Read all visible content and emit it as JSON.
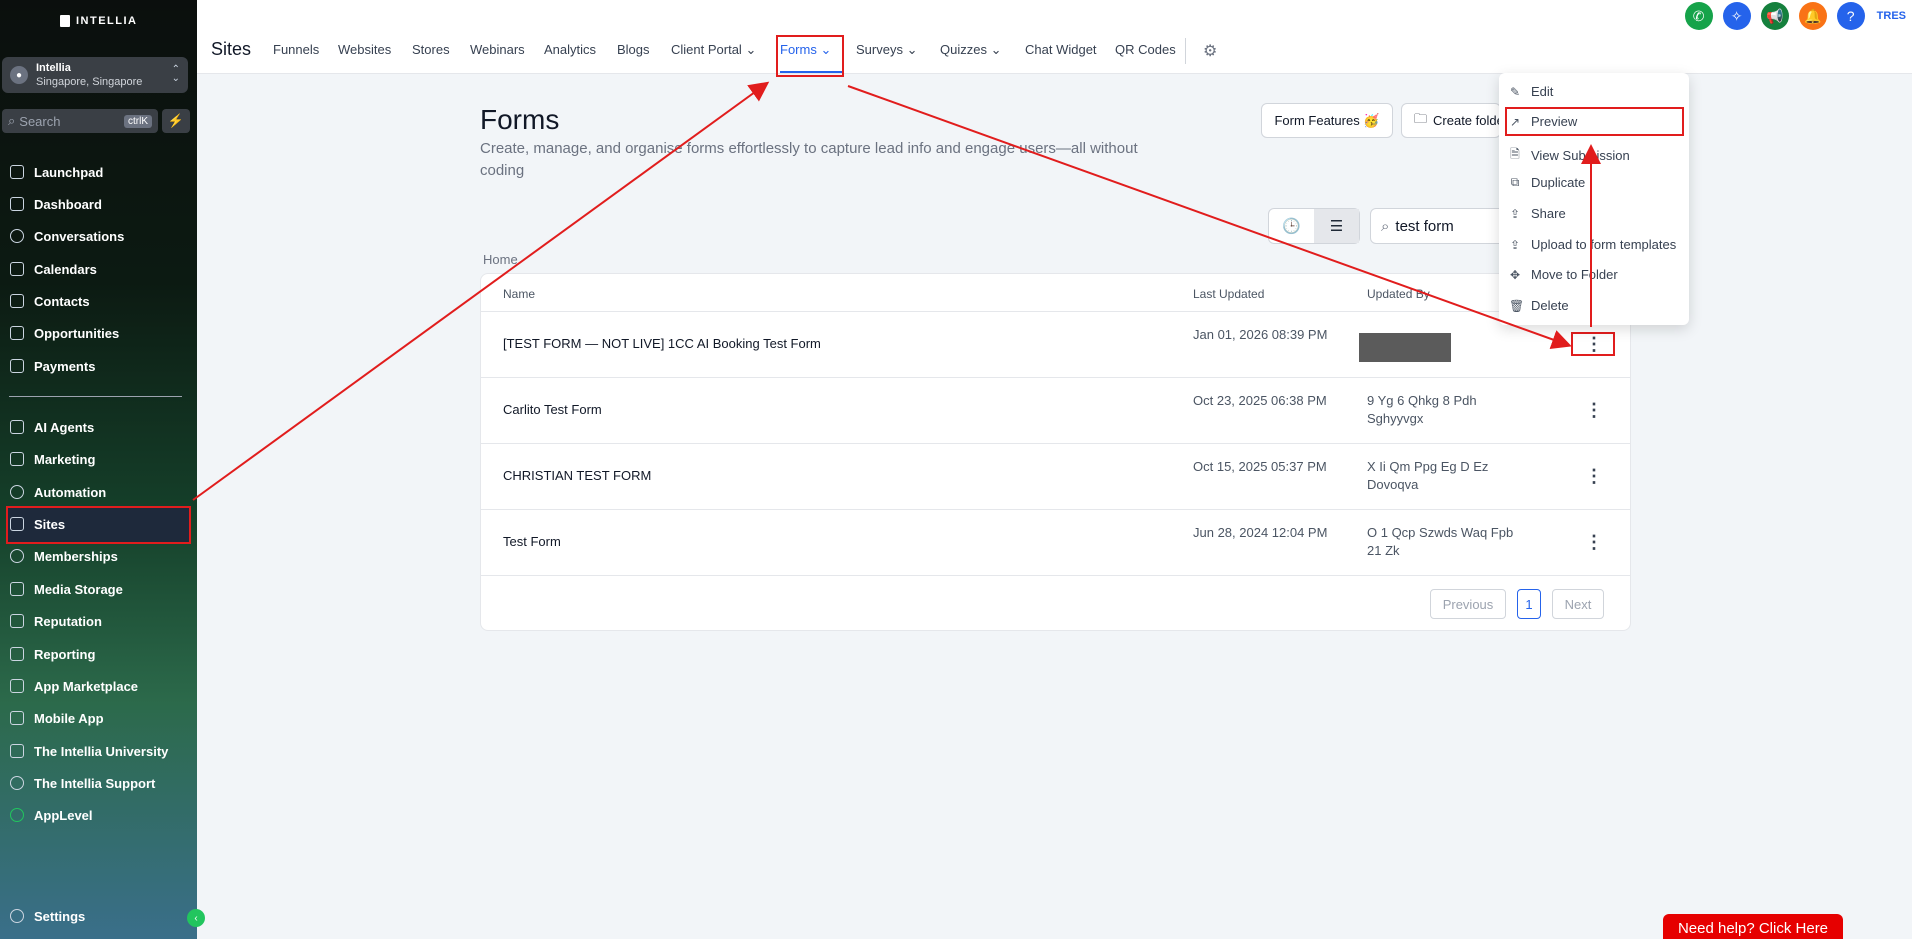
{
  "brand": "INTELLIA",
  "account": {
    "name": "Intellia",
    "location": "Singapore, Singapore"
  },
  "search": {
    "placeholder": "Search",
    "shortcut": "ctrlK"
  },
  "sidebar_top": [
    "Launchpad",
    "Dashboard",
    "Conversations",
    "Calendars",
    "Contacts",
    "Opportunities",
    "Payments"
  ],
  "sidebar_bottom": [
    "AI Agents",
    "Marketing",
    "Automation",
    "Sites",
    "Memberships",
    "Media Storage",
    "Reputation",
    "Reporting",
    "App Marketplace",
    "Mobile App",
    "The Intellia University",
    "The Intellia Support",
    "AppLevel"
  ],
  "settings": "Settings",
  "topnav": {
    "title": "Sites",
    "tabs": [
      "Funnels",
      "Websites",
      "Stores",
      "Webinars",
      "Analytics",
      "Blogs",
      "Client Portal",
      "Forms",
      "Surveys",
      "Quizzes",
      "Chat Widget",
      "QR Codes"
    ],
    "active_tab": "Forms",
    "user_initials": "TRES"
  },
  "page": {
    "title": "Forms",
    "subtitle": "Create, manage, and organise forms effortlessly to capture lead info and engage users—all without coding",
    "form_features_btn": "Form Features 🥳",
    "create_folder_btn": "Create folder",
    "search_value": "test form",
    "breadcrumb": "Home"
  },
  "table": {
    "columns": [
      "Name",
      "Last Updated",
      "Updated By"
    ],
    "rows": [
      {
        "name": "[TEST FORM — NOT LIVE] 1CC AI Booking Test Form",
        "date": "Jan 01, 2026 08:39 PM",
        "by": ""
      },
      {
        "name": "Carlito Test Form",
        "date": "Oct 23, 2025 06:38 PM",
        "by": "9 Yg 6 Qhkg 8 Pdh Sghyyvgx"
      },
      {
        "name": "CHRISTIAN TEST FORM",
        "date": "Oct 15, 2025 05:37 PM",
        "by": "X Ii Qm Ppg Eg D Ez Dovoqva"
      },
      {
        "name": "Test Form",
        "date": "Jun 28, 2024 12:04 PM",
        "by": "O 1 Qcp Szwds Waq Fpb 21 Zk"
      }
    ],
    "pager": {
      "prev": "Previous",
      "page": "1",
      "next": "Next"
    }
  },
  "menu": [
    "Edit",
    "Preview",
    "View Submission",
    "Duplicate",
    "Share",
    "Upload to form templates",
    "Move to Folder",
    "Delete"
  ],
  "help_button": "Need help? Click Here",
  "colors": {
    "accent": "#2563eb",
    "annotation": "#e11d1d",
    "help": "#e60000"
  }
}
